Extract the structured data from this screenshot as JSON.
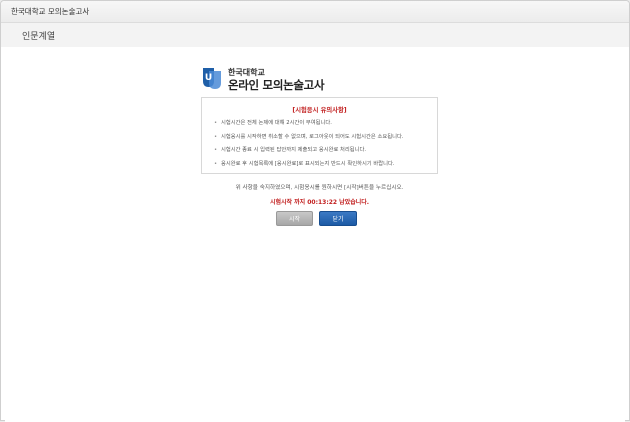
{
  "window": {
    "title": "한국대학교 모의논술고사"
  },
  "tab": {
    "label": "인문계열"
  },
  "logo": {
    "icon": "u-logo-icon",
    "small_text": "한국대학교",
    "large_text": "온라인 모의논술고사"
  },
  "notice": {
    "title": "[시험응시 유의사항]",
    "items": [
      "시험시간은 전체 논제에 대해 2시간이 부여됩니다.",
      "시험응시를 시작하면 취소할 수 없으며, 로그아웃이 되어도 시험시간은 소요됩니다.",
      "시험시간 종료 시 입력된 답안까지 제출되고 응시완료 처리됩니다.",
      "응시완료 후 시험목록에 [응시완료]로 표시되는지 반드시 확인하시기 바랍니다."
    ]
  },
  "instruction": "위 사항을 숙지하였으며, 시험응시를 원하시면 [시작]버튼을 누르십시오.",
  "countdown": "시험시작 까지 00:13:22 남았습니다.",
  "buttons": {
    "start": "시작",
    "close": "닫기"
  },
  "colors": {
    "accent": "#1c5aa5",
    "warning": "#c22020",
    "disabled": "#a7a7a7"
  }
}
